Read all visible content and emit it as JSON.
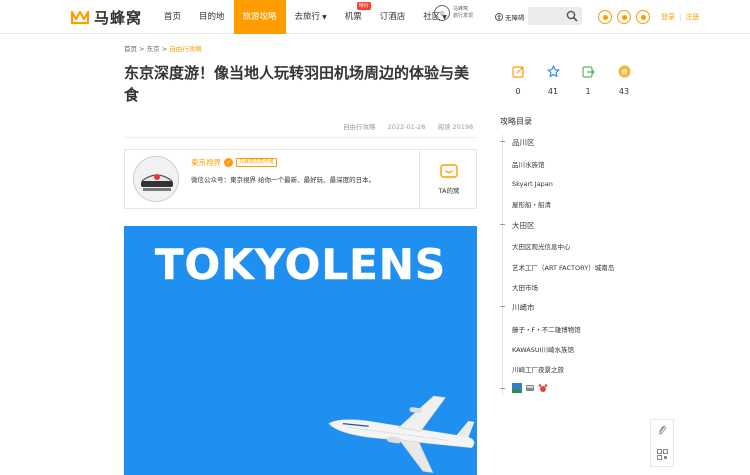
{
  "header": {
    "logo_text": "马蜂窝",
    "nav": [
      {
        "label": "首页"
      },
      {
        "label": "目的地"
      },
      {
        "label": "旅游攻略"
      },
      {
        "label": "去旅行"
      },
      {
        "label": "机票",
        "badge": "特价"
      },
      {
        "label": "订酒店"
      },
      {
        "label": "社区"
      }
    ],
    "promo_line1": "马蜂窝",
    "promo_line2": "旅行发现",
    "accessibility": "无障碍",
    "auth_login": "登录",
    "auth_register": "注册",
    "accent_color": "#ff9d00"
  },
  "breadcrumb": {
    "home": "首页",
    "sep1": ">",
    "city": "东京",
    "sep2": ">",
    "current": "自由行攻略"
  },
  "article": {
    "title": "东京深度游！像当地人玩转羽田机场周边的体验与美食",
    "category": "自由行攻略",
    "date": "2022-01-28",
    "views": "阅读 20198"
  },
  "author": {
    "name": "東京視界",
    "tag": "马蜂窝优质作者",
    "description": "微信公众号：東京視界 给你一个最新、最好玩、最深度的日本。",
    "ta_label": "TA的窝"
  },
  "hero": {
    "word": "TOKYOLENS"
  },
  "stats": [
    {
      "icon": "edit-icon",
      "value": "0"
    },
    {
      "icon": "star-icon",
      "value": "41"
    },
    {
      "icon": "share-icon",
      "value": "1"
    },
    {
      "icon": "honey-icon",
      "value": "43"
    }
  ],
  "toc": {
    "title": "攻略目录",
    "sections": [
      {
        "heading": "品川区",
        "items": [
          "品川水族馆",
          "Skyart Japan",
          "屋形船・船清"
        ]
      },
      {
        "heading": "大田区",
        "items": [
          "大田区观光信息中心",
          "艺术工厂（ART FACTORY）城南岛",
          "大田市场"
        ]
      },
      {
        "heading": "川崎市",
        "items": [
          "藤子・F・不二雄博物馆",
          "KAWASUI川崎水族馆",
          "川崎工厂夜景之旅"
        ]
      }
    ]
  }
}
